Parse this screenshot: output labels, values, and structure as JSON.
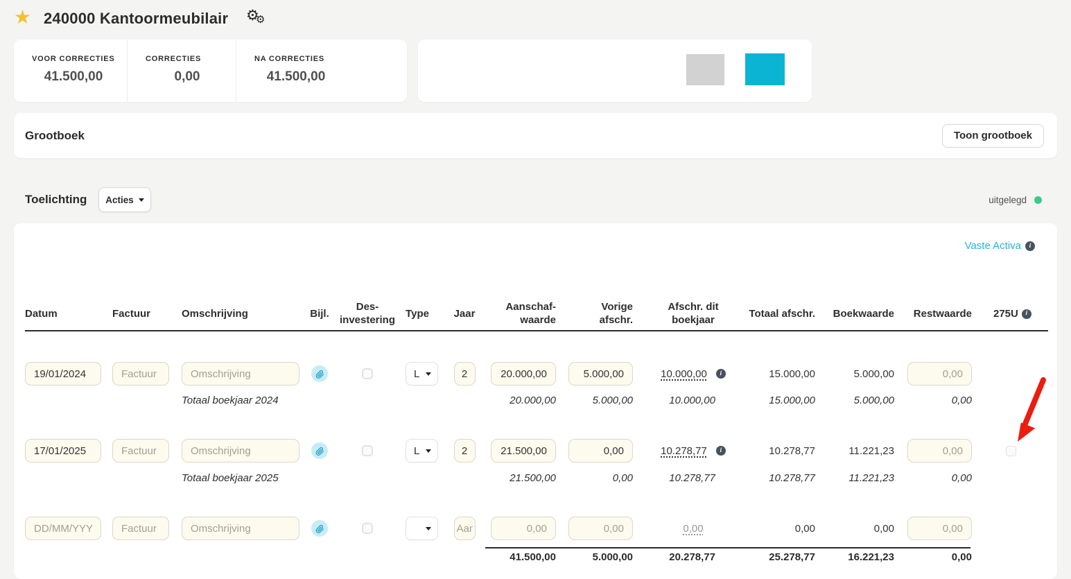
{
  "icons": {
    "star": "★",
    "gear": "⚙",
    "info_glyph": "i"
  },
  "header": {
    "title": "240000 Kantoormeubilair"
  },
  "summary": {
    "cards": [
      {
        "label": "VOOR CORRECTIES",
        "value": "41.500,00"
      },
      {
        "label": "CORRECTIES",
        "value": "0,00"
      },
      {
        "label": "NA CORRECTIES",
        "value": "41.500,00"
      }
    ]
  },
  "legend": {
    "gray_square_color": "#d2d2d2",
    "cyan_square_color": "#0cb4d4"
  },
  "grootboek": {
    "title": "Grootboek",
    "show_button_label": "Toon grootboek"
  },
  "toelichting": {
    "title": "Toelichting",
    "acties_label": "Acties",
    "status_label": "uitgelegd",
    "status_color": "#3ec98f"
  },
  "annotation": {
    "arrow_color": "#ec1c0e"
  },
  "table": {
    "section_link": "Vaste Activa",
    "headers": {
      "datum": "Datum",
      "factuur": "Factuur",
      "omschrijving": "Omschrijving",
      "bijl": "Bijl.",
      "desinvestering_1": "Des-",
      "desinvestering_2": "investering",
      "type": "Type",
      "jaar": "Jaar",
      "aanschafwaarde_1": "Aanschaf-",
      "aanschafwaarde_2": "waarde",
      "vorige_afschr": "Vorige afschr.",
      "afschr_dit_1": "Afschr. dit",
      "afschr_dit_2": "boekjaar",
      "totaal_afschr": "Totaal afschr.",
      "boekwaarde": "Boekwaarde",
      "restwaarde": "Restwaarde",
      "u275": "275U"
    },
    "rows": [
      {
        "datum": "19/01/2024",
        "factuur_placeholder": "Factuur",
        "omschrijving_placeholder": "Omschrijving",
        "type": "L",
        "jaar": "2",
        "aanschafwaarde": "20.000,00",
        "vorige_afschr": "5.000,00",
        "afschr_dit_boekjaar": "10.000,00",
        "totaal_afschr": "15.000,00",
        "boekwaarde": "5.000,00",
        "restwaarde_placeholder": "0,00"
      },
      {
        "datum": "17/01/2025",
        "factuur_placeholder": "Factuur",
        "omschrijving_placeholder": "Omschrijving",
        "type": "L",
        "jaar": "2",
        "aanschafwaarde": "21.500,00",
        "vorige_afschr": "0,00",
        "afschr_dit_boekjaar": "10.278,77",
        "totaal_afschr": "10.278,77",
        "boekwaarde": "11.221,23",
        "restwaarde_placeholder": "0,00"
      }
    ],
    "subtotals": [
      {
        "label": "Totaal boekjaar 2024",
        "aanschafwaarde": "20.000,00",
        "vorige_afschr": "5.000,00",
        "afschr_dit_boekjaar": "10.000,00",
        "totaal_afschr": "15.000,00",
        "boekwaarde": "5.000,00",
        "restwaarde": "0,00"
      },
      {
        "label": "Totaal boekjaar 2025",
        "aanschafwaarde": "21.500,00",
        "vorige_afschr": "0,00",
        "afschr_dit_boekjaar": "10.278,77",
        "totaal_afschr": "10.278,77",
        "boekwaarde": "11.221,23",
        "restwaarde": "0,00"
      }
    ],
    "new_row": {
      "datum_placeholder": "DD/MM/YYYY",
      "factuur_placeholder": "Factuur",
      "omschrijving_placeholder": "Omschrijving",
      "jaar_placeholder": "Aan",
      "aanschafwaarde_placeholder": "0,00",
      "vorige_afschr_placeholder": "0,00",
      "afschr_dit_boekjaar": "0,00",
      "totaal_afschr": "0,00",
      "boekwaarde": "0,00",
      "restwaarde_placeholder": "0,00"
    },
    "totals": {
      "aanschafwaarde": "41.500,00",
      "vorige_afschr": "5.000,00",
      "afschr_dit_boekjaar": "20.278,77",
      "totaal_afschr": "25.278,77",
      "boekwaarde": "16.221,23",
      "restwaarde": "0,00"
    }
  }
}
